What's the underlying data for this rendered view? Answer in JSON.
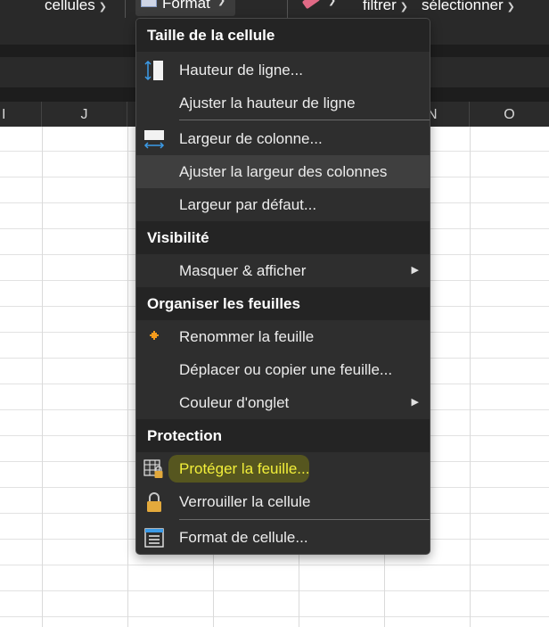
{
  "ribbon": {
    "cells_label": "cellules",
    "format_label": "Format",
    "filter_label": "filtrer",
    "select_label": "sélectionner"
  },
  "columns": [
    "I",
    "J",
    "N",
    "O"
  ],
  "menu": {
    "sections": [
      {
        "title": "Taille de la cellule",
        "items": [
          {
            "label": "Hauteur de ligne...",
            "icon": "row-height-icon"
          },
          {
            "label": "Ajuster la hauteur de ligne"
          },
          {
            "label": "Largeur de colonne...",
            "icon": "column-width-icon"
          },
          {
            "label": "Ajuster la largeur des colonnes"
          },
          {
            "label": "Largeur par défaut..."
          }
        ]
      },
      {
        "title": "Visibilité",
        "items": [
          {
            "label": "Masquer & afficher",
            "submenu": true
          }
        ]
      },
      {
        "title": "Organiser les feuilles",
        "items": [
          {
            "label": "Renommer la feuille",
            "icon": "rename-sheet-icon"
          },
          {
            "label": "Déplacer ou copier une feuille..."
          },
          {
            "label": "Couleur d'onglet",
            "submenu": true
          }
        ]
      },
      {
        "title": "Protection",
        "items": [
          {
            "label": "Protéger la feuille...",
            "icon": "protect-sheet-icon"
          },
          {
            "label": "Verrouiller la cellule",
            "icon": "lock-icon"
          },
          {
            "label": "Format de cellule...",
            "icon": "format-cells-icon"
          }
        ]
      }
    ]
  },
  "colors": {
    "menu_bg": "#2e2e2e",
    "section_bg": "#242424",
    "hover_bg": "#3f3f3f",
    "highlight_text": "#f2ef3a"
  }
}
